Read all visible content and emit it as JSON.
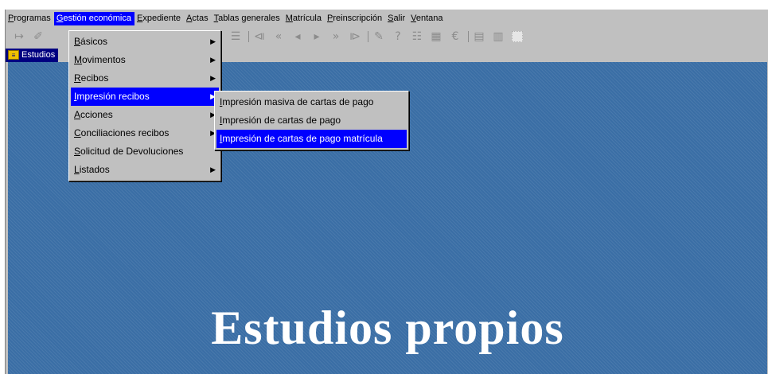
{
  "menubar": {
    "items": [
      {
        "label": "Programas",
        "accel": "P",
        "rest": "rogramas",
        "active": false
      },
      {
        "label": "Gestión económica",
        "accel": "G",
        "rest": "estión económica",
        "active": true
      },
      {
        "label": "Expediente",
        "accel": "E",
        "rest": "xpediente",
        "active": false
      },
      {
        "label": "Actas",
        "accel": "A",
        "rest": "ctas",
        "active": false
      },
      {
        "label": "Tablas generales",
        "accel": "T",
        "rest": "ablas generales",
        "active": false
      },
      {
        "label": "Matrícula",
        "accel": "M",
        "rest": "atrícula",
        "active": false
      },
      {
        "label": "Preinscripción",
        "accel": "P",
        "rest": "reinscripción",
        "active": false
      },
      {
        "label": "Salir",
        "accel": "S",
        "rest": "alir",
        "active": false
      },
      {
        "label": "Ventana",
        "accel": "V",
        "rest": "entana",
        "active": false
      }
    ]
  },
  "toolbar": {
    "icons": [
      "enter-icon",
      "open-icon",
      "separator",
      "query-icon",
      "execute-icon",
      "clear-icon",
      "separator",
      "first-record-icon",
      "prev-set-icon",
      "prev-record-icon",
      "next-record-icon",
      "next-set-icon",
      "last-record-icon",
      "separator",
      "edit-icon",
      "help-icon",
      "list-icon",
      "calendar-icon",
      "euro-icon",
      "separator",
      "doc-icon",
      "doc2-icon",
      "grid-icon"
    ]
  },
  "document_tab": {
    "label": "Estudios"
  },
  "main_menu": {
    "items": [
      {
        "label": "Básicos",
        "accel": "B",
        "rest": "ásicos",
        "submenu": true,
        "highlighted": false
      },
      {
        "label": "Movimentos",
        "accel": "M",
        "rest": "ovimentos",
        "submenu": true,
        "highlighted": false
      },
      {
        "label": "Recibos",
        "accel": "R",
        "rest": "ecibos",
        "submenu": true,
        "highlighted": false
      },
      {
        "label": "Impresión recibos",
        "accel": "I",
        "rest": "mpresión recibos",
        "submenu": true,
        "highlighted": true
      },
      {
        "label": "Acciones",
        "accel": "A",
        "rest": "cciones",
        "submenu": true,
        "highlighted": false
      },
      {
        "label": "Conciliaciones recibos",
        "accel": "C",
        "rest": "onciliaciones recibos",
        "submenu": true,
        "highlighted": false
      },
      {
        "label": "Solicitud de Devoluciones",
        "accel": "S",
        "rest": "olicitud de Devoluciones",
        "submenu": false,
        "highlighted": false
      },
      {
        "label": "Listados",
        "accel": "L",
        "rest": "istados",
        "submenu": true,
        "highlighted": false
      }
    ]
  },
  "submenu": {
    "items": [
      {
        "label": "Impresión masiva de cartas de pago",
        "accel": "I",
        "rest": "mpresión masiva de cartas de pago",
        "highlighted": false
      },
      {
        "label": "Impresión de cartas de pago",
        "accel": "I",
        "rest": "mpresión de cartas de pago",
        "highlighted": false
      },
      {
        "label": "Impresión de cartas de pago matrícula",
        "accel": "I",
        "rest": "mpresión de cartas de pago matrícula",
        "highlighted": true
      }
    ]
  },
  "workspace": {
    "title": "Estudios propios",
    "background_color": "#3a6ea5"
  },
  "colors": {
    "highlight": "#0000ff",
    "window_bg": "#c0c0c0"
  }
}
